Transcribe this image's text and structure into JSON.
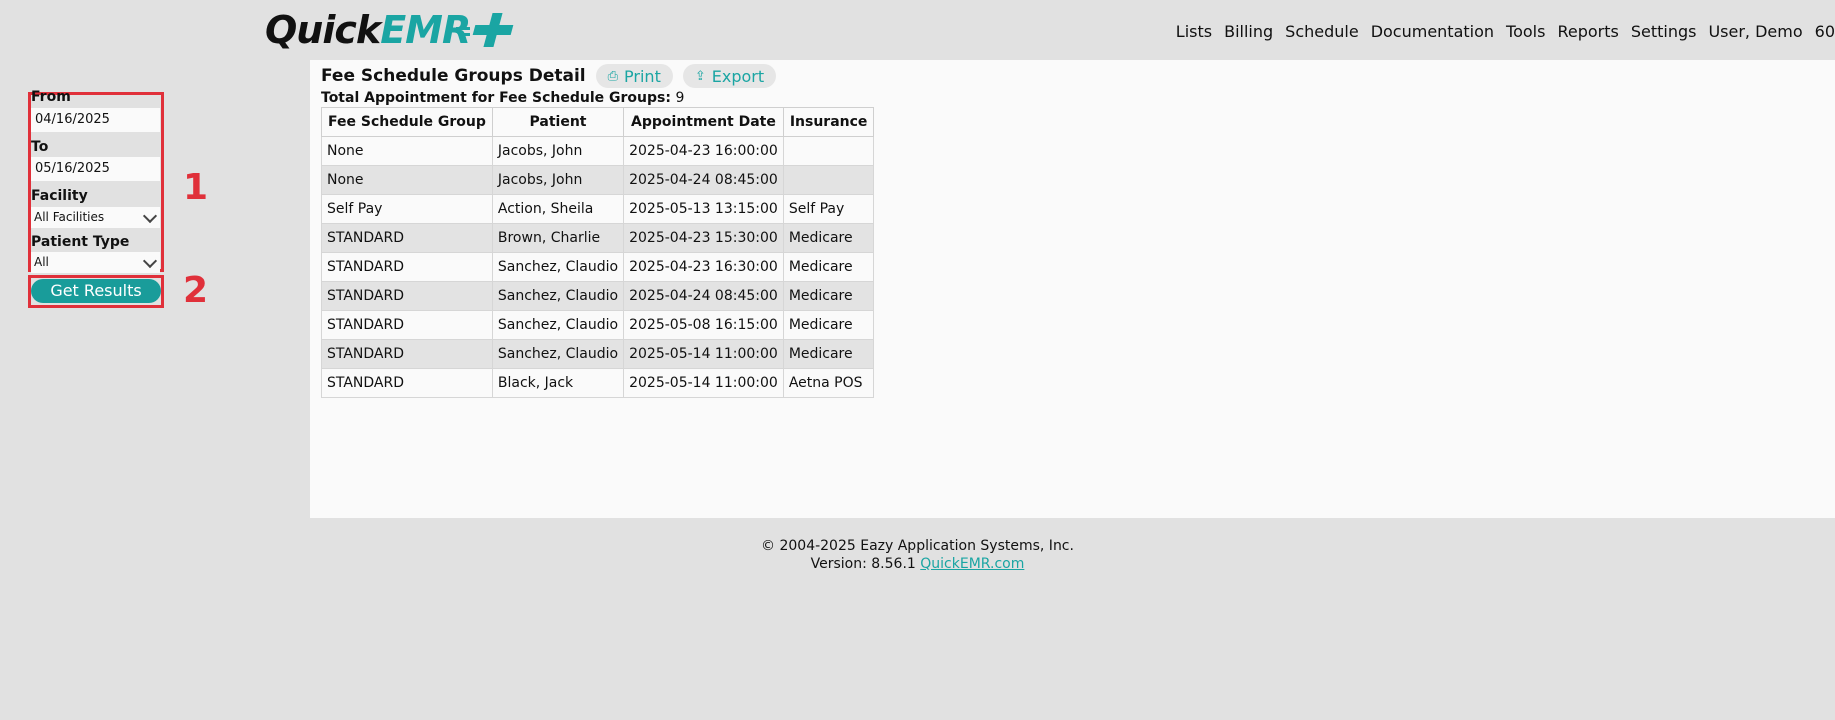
{
  "header": {
    "logo_quick": "Quick",
    "logo_emr": "EMR",
    "nav": [
      "Lists",
      "Billing",
      "Schedule",
      "Documentation",
      "Tools",
      "Reports",
      "Settings",
      "User, Demo",
      "60"
    ]
  },
  "filters": {
    "from_label": "From",
    "from_value": "04/16/2025",
    "to_label": "To",
    "to_value": "05/16/2025",
    "facility_label": "Facility",
    "facility_value": "All Facilities",
    "patient_type_label": "Patient Type",
    "patient_type_value": "All",
    "submit_label": "Get Results",
    "marker_1": "1",
    "marker_2": "2"
  },
  "report": {
    "title": "Fee Schedule Groups Detail",
    "print_label": "Print",
    "export_label": "Export",
    "total_label": "Total Appointment for Fee Schedule Groups:",
    "total_value": "9",
    "columns": [
      "Fee Schedule Group",
      "Patient",
      "Appointment Date",
      "Insurance"
    ],
    "rows": [
      [
        "None",
        "Jacobs, John",
        "2025-04-23 16:00:00",
        ""
      ],
      [
        "None",
        "Jacobs, John",
        "2025-04-24 08:45:00",
        ""
      ],
      [
        "Self Pay",
        "Action, Sheila",
        "2025-05-13 13:15:00",
        "Self Pay"
      ],
      [
        "STANDARD",
        "Brown, Charlie",
        "2025-04-23 15:30:00",
        "Medicare"
      ],
      [
        "STANDARD",
        "Sanchez, Claudio",
        "2025-04-23 16:30:00",
        "Medicare"
      ],
      [
        "STANDARD",
        "Sanchez, Claudio",
        "2025-04-24 08:45:00",
        "Medicare"
      ],
      [
        "STANDARD",
        "Sanchez, Claudio",
        "2025-05-08 16:15:00",
        "Medicare"
      ],
      [
        "STANDARD",
        "Sanchez, Claudio",
        "2025-05-14 11:00:00",
        "Medicare"
      ],
      [
        "STANDARD",
        "Black, Jack",
        "2025-05-14 11:00:00",
        "Aetna POS"
      ]
    ]
  },
  "footer": {
    "copyright": "© 2004-2025 Eazy Application Systems, Inc.",
    "version": "Version: 8.56.1",
    "link": "QuickEMR.com"
  },
  "colors": {
    "accent": "#1aa5a3",
    "highlight_border": "#e0303a"
  }
}
